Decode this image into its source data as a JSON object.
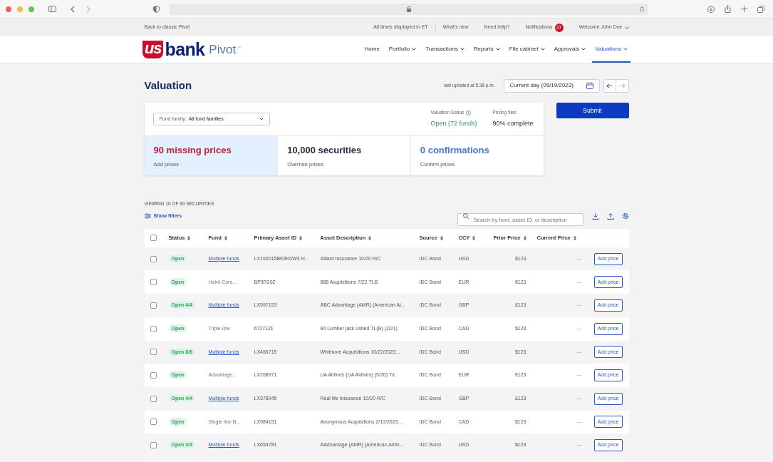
{
  "utility_bar": {
    "back_link": "Back to classic Pivot",
    "timezone_note": "All times displayed in ET",
    "links": [
      "What's new",
      "Need help?"
    ],
    "notifications": {
      "label": "Notifications",
      "count": "27"
    },
    "user": "Welcome John Doe"
  },
  "logo": {
    "mark": "us",
    "name": "bank",
    "product": "Pivot",
    "trademark": "™"
  },
  "nav": [
    {
      "label": "Home",
      "dropdown": false,
      "selected": false
    },
    {
      "label": "Portfolio",
      "dropdown": true,
      "selected": false
    },
    {
      "label": "Transactions",
      "dropdown": true,
      "selected": false
    },
    {
      "label": "Reports",
      "dropdown": true,
      "selected": false
    },
    {
      "label": "File cabinet",
      "dropdown": true,
      "selected": false
    },
    {
      "label": "Approvals",
      "dropdown": true,
      "selected": false
    },
    {
      "label": "Valuations",
      "dropdown": true,
      "selected": true
    }
  ],
  "page": {
    "title": "Valuation",
    "last_updated": "last updated at 5:38 p.m.",
    "date_picker": "Current day (05/19/2023)"
  },
  "summary": {
    "fund_family": {
      "label": "Fund family:",
      "value": "All fund families"
    },
    "valuation_status": {
      "label": "Valuation Status",
      "value": "Open (72 funds)"
    },
    "pricing_files": {
      "label": "Pricing files",
      "value": "90% complete"
    },
    "stats": [
      {
        "value": "90 missing prices",
        "caption": "Add prices",
        "color": "#b0263a",
        "selected": true
      },
      {
        "value": "10,000 securities",
        "caption": "Override prices",
        "color": "#2b2f45",
        "selected": false
      },
      {
        "value": "0 confirmations",
        "caption": "Confirm prices",
        "color": "#4a74d6",
        "selected": false
      }
    ]
  },
  "submit": "Submit",
  "table": {
    "viewing": "VIEWING 10 OF 90 SECURITIES",
    "show_filters": "Show filters",
    "search": {
      "placeholder": "Search by fund, asset ID, or description"
    },
    "header_checked": false,
    "columns": [
      "Status",
      "Fund",
      "Primary Asset ID",
      "Asset Description",
      "Source",
      "CCY",
      "Prior Price",
      "Current Price"
    ],
    "rows": [
      {
        "checked": false,
        "status": "Open",
        "fund": "Multiple funds",
        "fund_link": true,
        "asset_id": "LX192015BK8K0W3 H...",
        "description": "Alliant Insurance 10/20 R/C",
        "source": "IDC Bond",
        "ccy": "USD",
        "prior_price": "$123",
        "current_price": "—",
        "action": "Add price"
      },
      {
        "checked": false,
        "status": "Open",
        "fund": "Haird Core...",
        "fund_link": false,
        "asset_id": "BP3R202",
        "description": "888 Acquisitions 7/22 TLB",
        "source": "IDC Bond",
        "ccy": "EUR",
        "prior_price": "€123",
        "current_price": "—",
        "action": "Add price"
      },
      {
        "checked": false,
        "status": "Open 4/4",
        "fund": "Multiple funds",
        "fund_link": true,
        "asset_id": "LX597153",
        "description": "ABC Advantage (AMR) (American Ai...",
        "source": "IDC Bond",
        "ccy": "GBP",
        "prior_price": "£123",
        "current_price": "—",
        "action": "Add price"
      },
      {
        "checked": false,
        "status": "Open",
        "fund": "Triple-line",
        "fund_link": false,
        "asset_id": "6727121",
        "description": "84 Lumber jack united TL(B) (2/21)",
        "source": "IDC Bond",
        "ccy": "CAD",
        "prior_price": "$123",
        "current_price": "—",
        "action": "Add price"
      },
      {
        "checked": false,
        "status": "Open 8/8",
        "fund": "Multiple funds",
        "fund_link": true,
        "asset_id": "LX456715",
        "description": "Whitmore Acquisitions 10/22/2023...",
        "source": "IDC Bond",
        "ccy": "USD",
        "prior_price": "$123",
        "current_price": "—",
        "action": "Add price"
      },
      {
        "checked": false,
        "status": "Open",
        "fund": "Advantage...",
        "fund_link": false,
        "asset_id": "LX268971",
        "description": "UA Airlines (UA Airlines) (5/20) T/L",
        "source": "IDC Bond",
        "ccy": "EUR",
        "prior_price": "€123",
        "current_price": "—",
        "action": "Add price"
      },
      {
        "checked": false,
        "status": "Open 4/4",
        "fund": "Multiple funds",
        "fund_link": true,
        "asset_id": "LX378945",
        "description": "Real life Insurance 10/20 R/C",
        "source": "IDC Bond",
        "ccy": "GBP",
        "prior_price": "£123",
        "current_price": "—",
        "action": "Add price"
      },
      {
        "checked": false,
        "status": "Open",
        "fund": "Single line B...",
        "fund_link": false,
        "asset_id": "LX984151",
        "description": "Anonymous Acquisitions 2/10/2023...",
        "source": "IDC Bond",
        "ccy": "CAD",
        "prior_price": "$123",
        "current_price": "—",
        "action": "Add price"
      },
      {
        "checked": false,
        "status": "Open 3/3",
        "fund": "Multiple funds",
        "fund_link": true,
        "asset_id": "LX654781",
        "description": "AAdvantage (AMR) (American Airlin...",
        "source": "IDC Bond",
        "ccy": "USD",
        "prior_price": "$123",
        "current_price": "—",
        "action": "Add price"
      }
    ]
  }
}
